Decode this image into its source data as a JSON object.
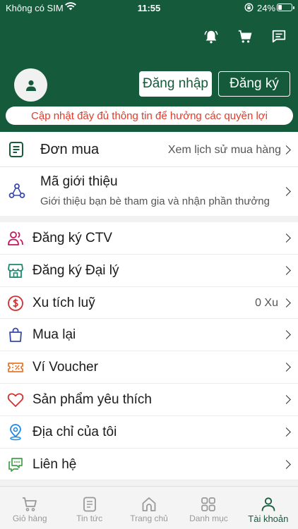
{
  "status_bar": {
    "carrier": "Không có SIM",
    "time": "11:55",
    "battery": "24%"
  },
  "header": {
    "icons": [
      "bell-icon",
      "cart-icon",
      "message-icon"
    ],
    "login_label": "Đăng nhập",
    "register_label": "Đăng ký",
    "promo_text": "Cập nhật đầy đủ thông tin để hưởng các quyền lợi"
  },
  "orders": {
    "title": "Đơn mua",
    "link": "Xem lịch sử mua hàng"
  },
  "referral": {
    "title": "Mã giới thiệu",
    "subtitle": "Giới thiệu bạn bè tham gia và nhận phần thưởng"
  },
  "menu": [
    {
      "label": "Đăng ký CTV",
      "icon": "users-icon",
      "value": ""
    },
    {
      "label": "Đăng ký Đại lý",
      "icon": "store-icon",
      "value": ""
    },
    {
      "label": "Xu tích luỹ",
      "icon": "coin-icon",
      "value": "0 Xu"
    },
    {
      "label": "Mua lại",
      "icon": "shopping-bag-icon",
      "value": ""
    },
    {
      "label": "Ví Voucher",
      "icon": "voucher-icon",
      "value": ""
    },
    {
      "label": "Sản phẩm yêu thích",
      "icon": "heart-icon",
      "value": ""
    },
    {
      "label": "Địa chỉ của tôi",
      "icon": "location-pin-icon",
      "value": ""
    },
    {
      "label": "Liên hệ",
      "icon": "chat-icon",
      "value": ""
    }
  ],
  "tabbar": [
    {
      "label": "Giỏ hàng",
      "icon": "cart-icon"
    },
    {
      "label": "Tin tức",
      "icon": "news-icon"
    },
    {
      "label": "Trang chủ",
      "icon": "home-icon"
    },
    {
      "label": "Danh mục",
      "icon": "grid-icon"
    },
    {
      "label": "Tài khoản",
      "icon": "user-icon",
      "active": true
    }
  ],
  "colors": {
    "brand": "#145a3b",
    "promo_text": "#e23b2b",
    "menu_icon_users": "#c2185b",
    "menu_icon_store": "#1a8a6e",
    "menu_icon_coin": "#d32f2f",
    "menu_icon_bag": "#3949ab",
    "menu_icon_voucher": "#e8772e",
    "menu_icon_heart": "#d32f2f",
    "menu_icon_pin": "#1e88e5",
    "menu_icon_chat": "#43a047"
  }
}
